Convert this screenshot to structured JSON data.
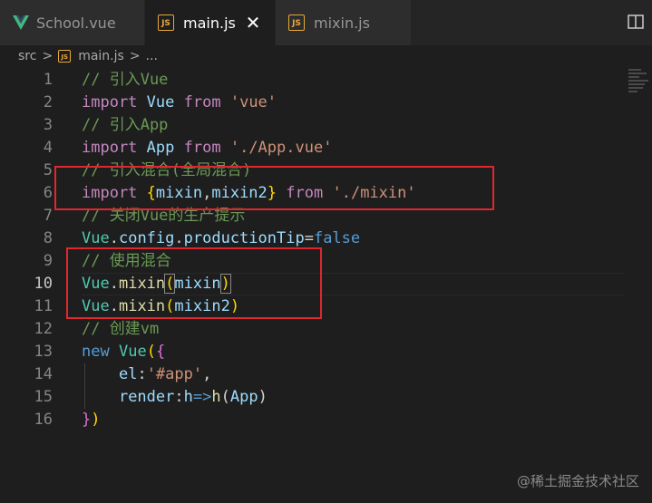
{
  "tabs": [
    {
      "label": "School.vue",
      "icon": "vue-icon",
      "active": false
    },
    {
      "label": "main.js",
      "icon": "js-icon",
      "active": true
    },
    {
      "label": "mixin.js",
      "icon": "js-icon",
      "active": false
    }
  ],
  "tab_icon_text": "JS",
  "close_glyph": "✕",
  "breadcrumb": {
    "folder": "src",
    "sep": ">",
    "file": "main.js",
    "more": "..."
  },
  "line_numbers": [
    "1",
    "2",
    "3",
    "4",
    "5",
    "6",
    "7",
    "8",
    "9",
    "10",
    "11",
    "12",
    "13",
    "14",
    "15",
    "16"
  ],
  "current_line": "10",
  "code": {
    "l1": "// 引入Vue",
    "l2_kw": "import",
    "l2_name": "Vue",
    "l2_from": "from",
    "l2_str": "'vue'",
    "l3": "// 引入App",
    "l4_kw": "import",
    "l4_name": "App",
    "l4_from": "from",
    "l4_str": "'./App.vue'",
    "l5": "// 引入混合(全局混合)",
    "l6_kw": "import",
    "l6_open": "{",
    "l6_a": "mixin",
    "l6_comma": ",",
    "l6_b": "mixin2",
    "l6_close": "}",
    "l6_from": "from",
    "l6_str": "'./mixin'",
    "l7": "// 关闭Vue的生产提示",
    "l8_a": "Vue",
    "l8_dot1": ".",
    "l8_b": "config",
    "l8_dot2": ".",
    "l8_c": "productionTip",
    "l8_eq": "=",
    "l8_val": "false",
    "l9": "// 使用混合",
    "l10_a": "Vue",
    "l10_dot": ".",
    "l10_fn": "mixin",
    "l10_open": "(",
    "l10_arg": "mixin",
    "l10_close": ")",
    "l11_a": "Vue",
    "l11_dot": ".",
    "l11_fn": "mixin",
    "l11_open": "(",
    "l11_arg": "mixin2",
    "l11_close": ")",
    "l12": "// 创建vm",
    "l13_kw": "new",
    "l13_cls": "Vue",
    "l13_open": "(",
    "l13_brace": "{",
    "l14_key": "el",
    "l14_colon": ":",
    "l14_str": "'#app'",
    "l14_comma": ",",
    "l15_key": "render",
    "l15_colon": ":",
    "l15_param": "h",
    "l15_arrow": "=>",
    "l15_fn": "h",
    "l15_open": "(",
    "l15_arg": "App",
    "l15_close": ")",
    "l16_brace": "}",
    "l16_paren": ")"
  },
  "highlight_color": "#e0262f",
  "watermark": "@稀土掘金技术社区"
}
